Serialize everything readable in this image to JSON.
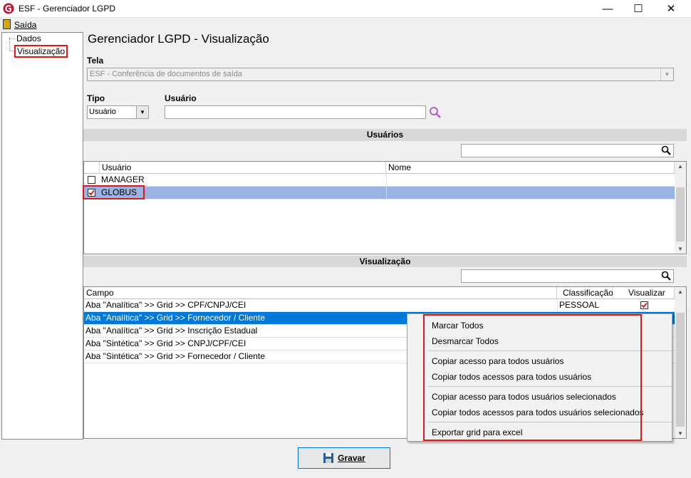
{
  "window": {
    "title": "ESF - Gerenciador LGPD",
    "minimize": "—",
    "maximize": "☐",
    "close": "✕"
  },
  "menu": {
    "saida": "Saída"
  },
  "tree": {
    "items": [
      {
        "label": "Dados"
      },
      {
        "label": "Visualização"
      }
    ]
  },
  "page": {
    "title": "Gerenciador LGPD - Visualização"
  },
  "tela": {
    "label": "Tela",
    "value": "ESF - Conferência de documentos de saída"
  },
  "tipo": {
    "label": "Tipo",
    "value": "Usuário"
  },
  "usuario": {
    "label": "Usuário",
    "value": ""
  },
  "users_section": {
    "title": "Usuários",
    "search_value": "",
    "columns": [
      "Usuário",
      "Nome"
    ],
    "rows": [
      {
        "usuario": "MANAGER",
        "nome": "",
        "checked": false
      },
      {
        "usuario": "GLOBUS",
        "nome": "",
        "checked": true
      }
    ]
  },
  "view_section": {
    "title": "Visualização",
    "search_value": "",
    "columns": [
      "Campo",
      "Classificação",
      "Visualizar"
    ],
    "rows": [
      {
        "campo": "Aba \"Analítica\" >> Grid >> CPF/CNPJ/CEI",
        "classificacao": "PESSOAL",
        "visualizar": true
      },
      {
        "campo": "Aba \"Analítica\" >> Grid >> Fornecedor / Cliente",
        "classificacao": "",
        "visualizar": false
      },
      {
        "campo": "Aba \"Analítica\" >> Grid >> Inscrição Estadual",
        "classificacao": "",
        "visualizar": false
      },
      {
        "campo": "Aba \"Sintética\" >> Grid >>  CNPJ/CPF/CEI",
        "classificacao": "",
        "visualizar": false
      },
      {
        "campo": "Aba \"Sintética\" >> Grid >> Fornecedor / Cliente",
        "classificacao": "",
        "visualizar": false
      }
    ]
  },
  "context_menu": {
    "items": [
      "Marcar Todos",
      "Desmarcar Todos",
      "Copiar acesso para todos usuários",
      "Copiar todos acessos para todos usuários",
      "Copiar acesso para todos usuários selecionados",
      "Copiar todos acessos para todos usuários selecionados",
      "Exportar grid para excel"
    ]
  },
  "footer": {
    "save_label": "Gravar"
  },
  "colors": {
    "highlight": "#e01818",
    "selection": "#0078d7",
    "row_selected": "#99b4e3",
    "accent_icon": "#c060c0"
  }
}
